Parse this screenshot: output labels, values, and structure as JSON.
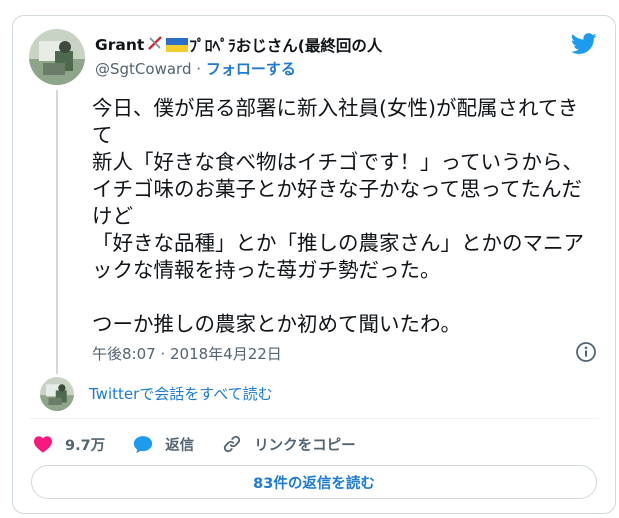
{
  "author": {
    "name_prefix": "Grant",
    "name_suffix": "ﾌﾟﾛﾍﾟﾗおじさん(最終回の人",
    "handle": "@SgtCoward",
    "separator": "·",
    "follow_label": "フォローする"
  },
  "tweet": {
    "lines": [
      "今日、僕が居る部署に新入社員(女性)が配属されてきて",
      "新人「好きな食べ物はイチゴです！」っていうから、イチゴ味のお菓子とか好きな子かなって思ってたんだけど",
      "「好きな品種」とか「推しの農家さん」とかのマニアックな情報を持った苺ガチ勢だった。",
      "つーか推しの農家とか初めて聞いたわ。"
    ],
    "timestamp": "午後8:07 · 2018年4月22日"
  },
  "conversation": {
    "read_label": "Twitterで会話をすべて読む"
  },
  "actions": {
    "like_count": "9.7万",
    "reply_label": "返信",
    "copy_link_label": "リンクをコピー"
  },
  "replies_button": {
    "label": "83件の返信を読む"
  },
  "colors": {
    "accent": "#1d7bd4",
    "like": "#f91880",
    "secondary_text": "#536471",
    "twitter_blue": "#1d9bf0"
  },
  "icons": {
    "logo": "twitter-bird-icon",
    "info": "info-icon",
    "like": "heart-icon",
    "reply": "speech-bubble-icon",
    "copy_link": "link-icon"
  }
}
